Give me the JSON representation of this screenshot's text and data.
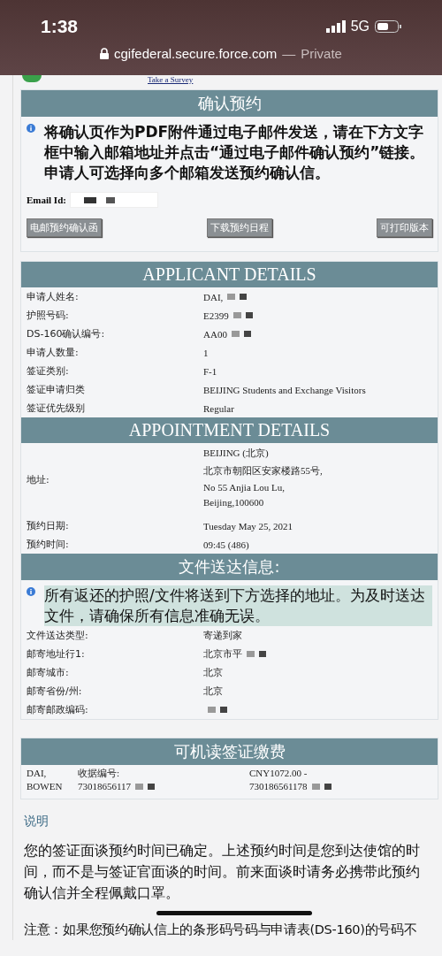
{
  "status_bar": {
    "time": "1:38",
    "network": "5G"
  },
  "address_bar": {
    "url": "cgifederal.secure.force.com",
    "separator": "—",
    "mode": "Private"
  },
  "survey_link": "Take a Survey",
  "confirm": {
    "title": "确认预约",
    "info": "将确认页作为PDF附件通过电子邮件发送，请在下方文字框中输入邮箱地址并点击“通过电子邮件确认预约”链接。申请人可选择向多个邮箱发送预约确认信。",
    "email_label": "Email Id:",
    "buttons": [
      "电邮预约确认函",
      "下载预约日程",
      "可打印版本"
    ]
  },
  "applicant": {
    "title": "APPLICANT DETAILS",
    "rows": [
      {
        "label": "申请人姓名:",
        "value": "DAI,",
        "redacted": true
      },
      {
        "label": "护照号码:",
        "value": "E2399",
        "redacted": true
      },
      {
        "label": "DS-160确认编号:",
        "value": "AA00",
        "redacted": true
      },
      {
        "label": "申请人数量:",
        "value": "1",
        "redacted": false
      },
      {
        "label": "签证类别:",
        "value": "F-1",
        "redacted": false
      },
      {
        "label": "签证申请归类",
        "value": "BEIJING Students and Exchange Visitors",
        "redacted": false
      },
      {
        "label": "签证优先级别",
        "value": "Regular",
        "redacted": false
      }
    ]
  },
  "appointment": {
    "title": "APPOINTMENT DETAILS",
    "rows": [
      {
        "label": "地址:",
        "lines": [
          "BEIJING (北京)",
          "北京市朝阳区安家楼路55号,",
          "No 55 Anjia Lou Lu,",
          "Beijing,100600"
        ]
      },
      {
        "label": "预约日期:",
        "lines": [
          "Tuesday May 25, 2021"
        ]
      },
      {
        "label": "预约时间:",
        "lines": [
          "09:45 (486)"
        ]
      }
    ]
  },
  "delivery": {
    "title": "文件送达信息:",
    "info": "所有返还的护照/文件将送到下方选择的地址。为及时送达文件，请确保所有信息准确无误。",
    "rows": [
      {
        "label": "文件送达类型:",
        "value": "寄递到家",
        "redacted": false
      },
      {
        "label": "邮寄地址行1:",
        "value": "北京市平",
        "redacted": true
      },
      {
        "label": "邮寄城市:",
        "value": "北京",
        "redacted": false
      },
      {
        "label": "邮寄省份/州:",
        "value": "北京",
        "redacted": false
      },
      {
        "label": "邮寄邮政编码:",
        "value": "",
        "redacted": true
      }
    ]
  },
  "fee": {
    "title": "可机读签证缴费",
    "name": "DAI, BOWEN",
    "receipt_label": "收据编号:",
    "receipt": "73018656117",
    "amount": "CNY1072.00 -",
    "amount_ref": "730186561178"
  },
  "notes": {
    "title": "说明",
    "paragraphs": [
      "您的签证面谈预约时间已确定。上述预约时间是您到达使馆的时间，而不是与签证官面谈的时间。前来面谈时请务必携带此预约确认信并全程佩戴口罩。",
      "注意：如果您预约确认信上的条形码号码与申请表(DS-160)的号码不"
    ]
  }
}
